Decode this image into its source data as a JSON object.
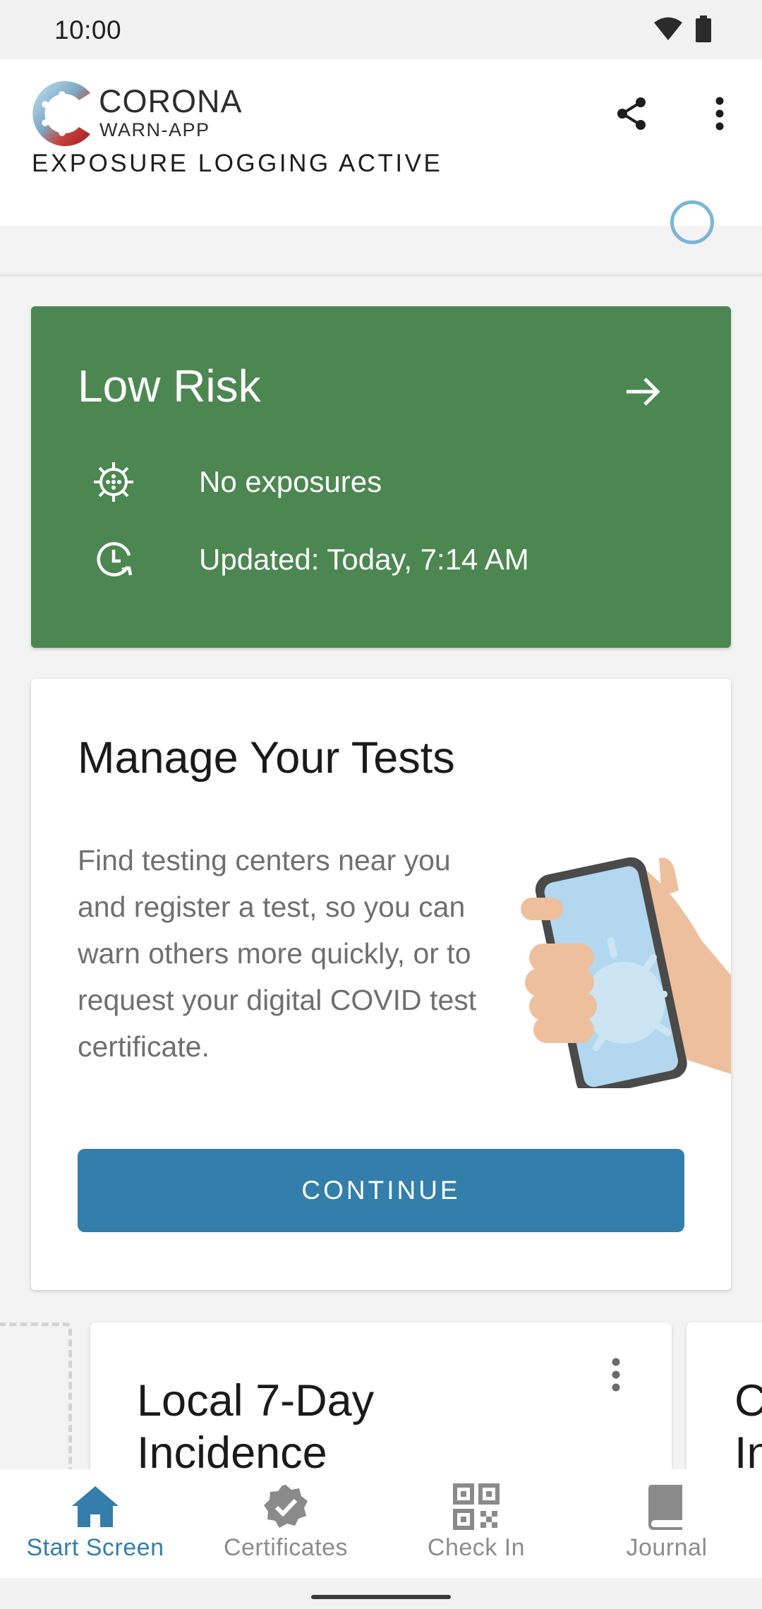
{
  "status_bar": {
    "time": "10:00",
    "icons": [
      "wifi-icon",
      "battery-icon"
    ]
  },
  "app_bar": {
    "logo_title": "CORONA",
    "logo_subtitle": "WARN-APP",
    "actions": [
      "share-icon",
      "more-vert-icon"
    ]
  },
  "exposure": {
    "label": "EXPOSURE LOGGING ACTIVE",
    "indicator_color": "#7cb4d6"
  },
  "risk_card": {
    "title": "Low Risk",
    "color": "#4c8751",
    "rows": [
      {
        "icon": "virus-icon",
        "text": "No exposures"
      },
      {
        "icon": "clock-refresh-icon",
        "text": "Updated: Today, 7:14 AM"
      }
    ]
  },
  "tests_card": {
    "title": "Manage Your Tests",
    "body": "Find testing centers near you and register a test, so you can warn others more quickly, or to request your digital COVID test certificate.",
    "button": "CONTINUE",
    "accent": "#337eab"
  },
  "statistics": {
    "card_title": "Local 7-Day Incidence",
    "next_card_title": "C\nIn"
  },
  "bottom_nav": {
    "items": [
      {
        "label": "Start Screen",
        "icon": "home-icon",
        "active": true
      },
      {
        "label": "Certificates",
        "icon": "certificate-badge-icon",
        "active": false
      },
      {
        "label": "Check In",
        "icon": "qr-code-icon",
        "active": false
      },
      {
        "label": "Journal",
        "icon": "book-icon",
        "active": false
      }
    ]
  }
}
